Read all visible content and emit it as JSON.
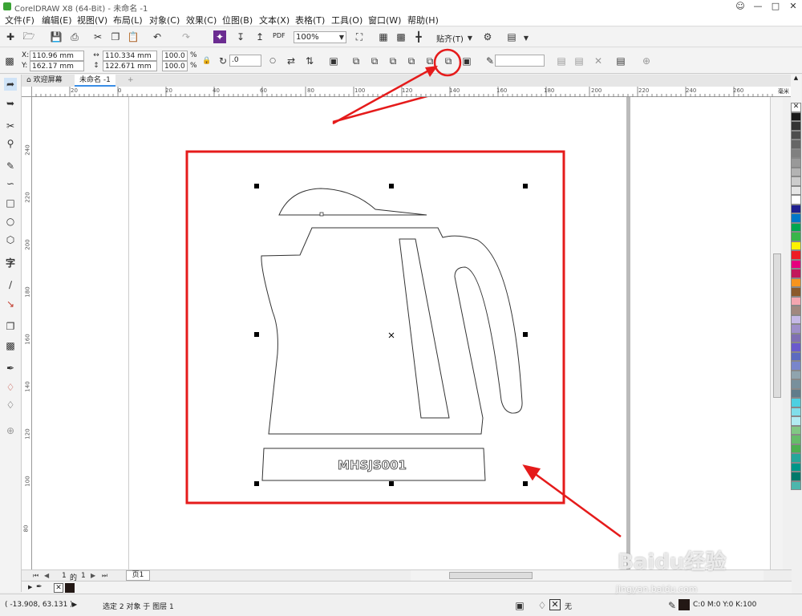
{
  "window": {
    "title": "CorelDRAW X8 (64-Bit) - 未命名 -1"
  },
  "menu": [
    "文件(F)",
    "编辑(E)",
    "视图(V)",
    "布局(L)",
    "对象(C)",
    "效果(C)",
    "位图(B)",
    "文本(X)",
    "表格(T)",
    "工具(O)",
    "窗口(W)",
    "帮助(H)"
  ],
  "toolbar": {
    "zoom": "100%",
    "snap": "贴齐(T)",
    "pdf": "PDF"
  },
  "props": {
    "x": "110.96 mm",
    "y": "162.17 mm",
    "w": "110.334 mm",
    "h": "122.671 mm",
    "sx": "100.0",
    "sy": "100.0",
    "pct": "%",
    "angle": ".0",
    "x_label": "X:",
    "y_label": "Y:"
  },
  "tabs": {
    "welcome": "欢迎屏幕",
    "doc": "未命名 -1"
  },
  "ruler_h": [
    "40",
    "20",
    "0",
    "20",
    "40",
    "60",
    "80",
    "100",
    "120",
    "140",
    "160",
    "180",
    "200",
    "220",
    "240",
    "260"
  ],
  "ruler_v": [
    "240",
    "220",
    "200",
    "180",
    "160",
    "140",
    "120",
    "100",
    "80"
  ],
  "ruler_unit": "毫米",
  "artwork": {
    "label": "MHSJS001"
  },
  "pagenav": {
    "current": "1",
    "of": "的",
    "total": "1",
    "page": "页1"
  },
  "status": {
    "coords": "( -13.908, 63.131 )",
    "selection": "选定 2 对象 于 图层 1",
    "fill": "无",
    "color": "C:0 M:0 Y:0 K:100"
  },
  "watermark": {
    "brand": "Baidu经验",
    "url": "jingyan.baidu.com"
  },
  "palette": [
    "#1a1a1a",
    "#333333",
    "#4d4d4d",
    "#666666",
    "#808080",
    "#999999",
    "#b3b3b3",
    "#cccccc",
    "#e6e6e6",
    "#ffffff",
    "#1f1f8f",
    "#0077c8",
    "#00a651",
    "#39b54a",
    "#fff200",
    "#ed1c24",
    "#e6007e",
    "#c2185b",
    "#f7941d",
    "#8b5a2b",
    "#f4a6b0",
    "#a1887f",
    "#c5b9e6",
    "#9e8fc9",
    "#7f6fb3",
    "#6a5acd",
    "#5c6bc0",
    "#7986cb",
    "#90a4ae",
    "#78909c",
    "#607d8b",
    "#4dd0e1",
    "#80deea",
    "#b2ebf2",
    "#81c784",
    "#66bb6a",
    "#4caf50",
    "#26a69a",
    "#009688",
    "#00796b",
    "#4db6ac"
  ],
  "accent": "#e51b1b"
}
